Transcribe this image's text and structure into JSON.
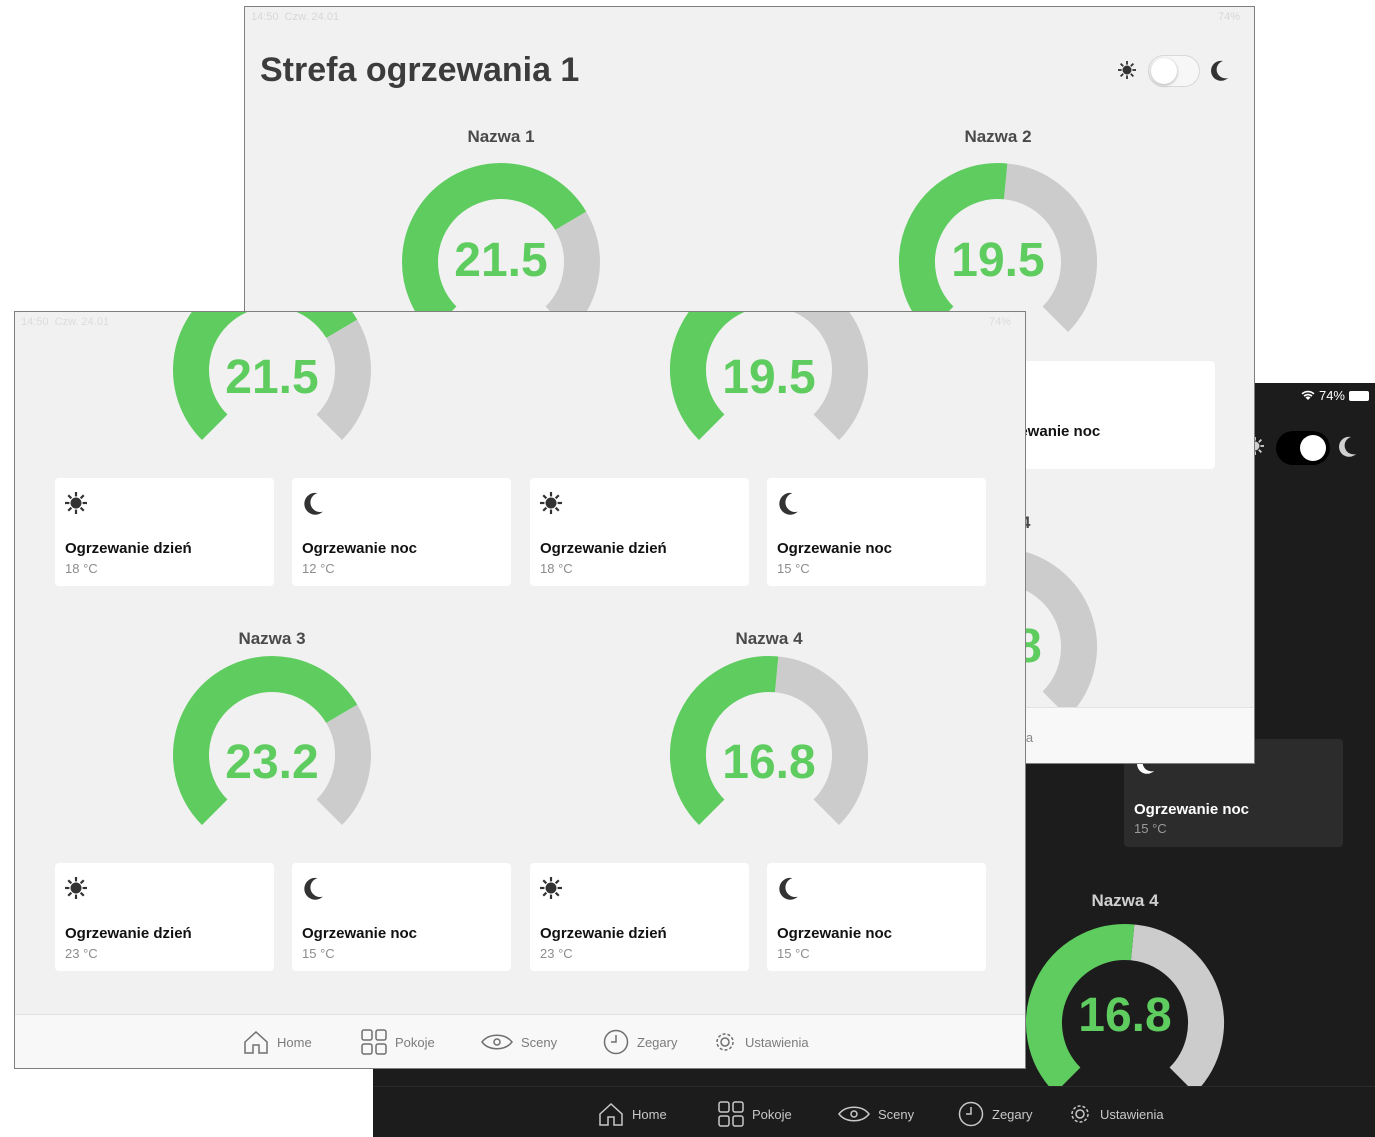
{
  "colors": {
    "accent": "#5fcc60",
    "track": "#cccccc",
    "dark_bg": "#1c1c1c",
    "light_bg": "#f1f1f1"
  },
  "status": {
    "time": "14:50",
    "date": "Czw. 24.01",
    "battery": "74%"
  },
  "page_title": "Strefa ogrzewania 1",
  "card_labels": {
    "day": "Ogrzewanie dzień",
    "night": "Ogrzewanie noc"
  },
  "zones": [
    {
      "name": "Nazwa 1",
      "temp": "21.5",
      "fill": 0.72,
      "day": "18 °C",
      "night": "12 °C"
    },
    {
      "name": "Nazwa 2",
      "temp": "19.5",
      "fill": 0.52,
      "day": "18 °C",
      "night": "15 °C"
    },
    {
      "name": "Nazwa 3",
      "temp": "23.2",
      "fill": 0.72,
      "day": "23 °C",
      "night": "15 °C"
    },
    {
      "name": "Nazwa 4",
      "temp": "16.8",
      "fill": 0.52,
      "day": "23 °C",
      "night": "15 °C"
    }
  ],
  "back_fragments": {
    "night_label": "rzewanie noc",
    "night_value": "°C",
    "zone4_digit": "4",
    "temp_digit": "8",
    "nav_frag": "ia"
  },
  "dark": {
    "night_label": "Ogrzewanie noc",
    "night_value": "15 °C",
    "zone_title": "Nazwa 4",
    "temp": "16.8"
  },
  "nav": {
    "home": "Home",
    "rooms": "Pokoje",
    "scenes": "Sceny",
    "clocks": "Zegary",
    "settings": "Ustawienia"
  }
}
